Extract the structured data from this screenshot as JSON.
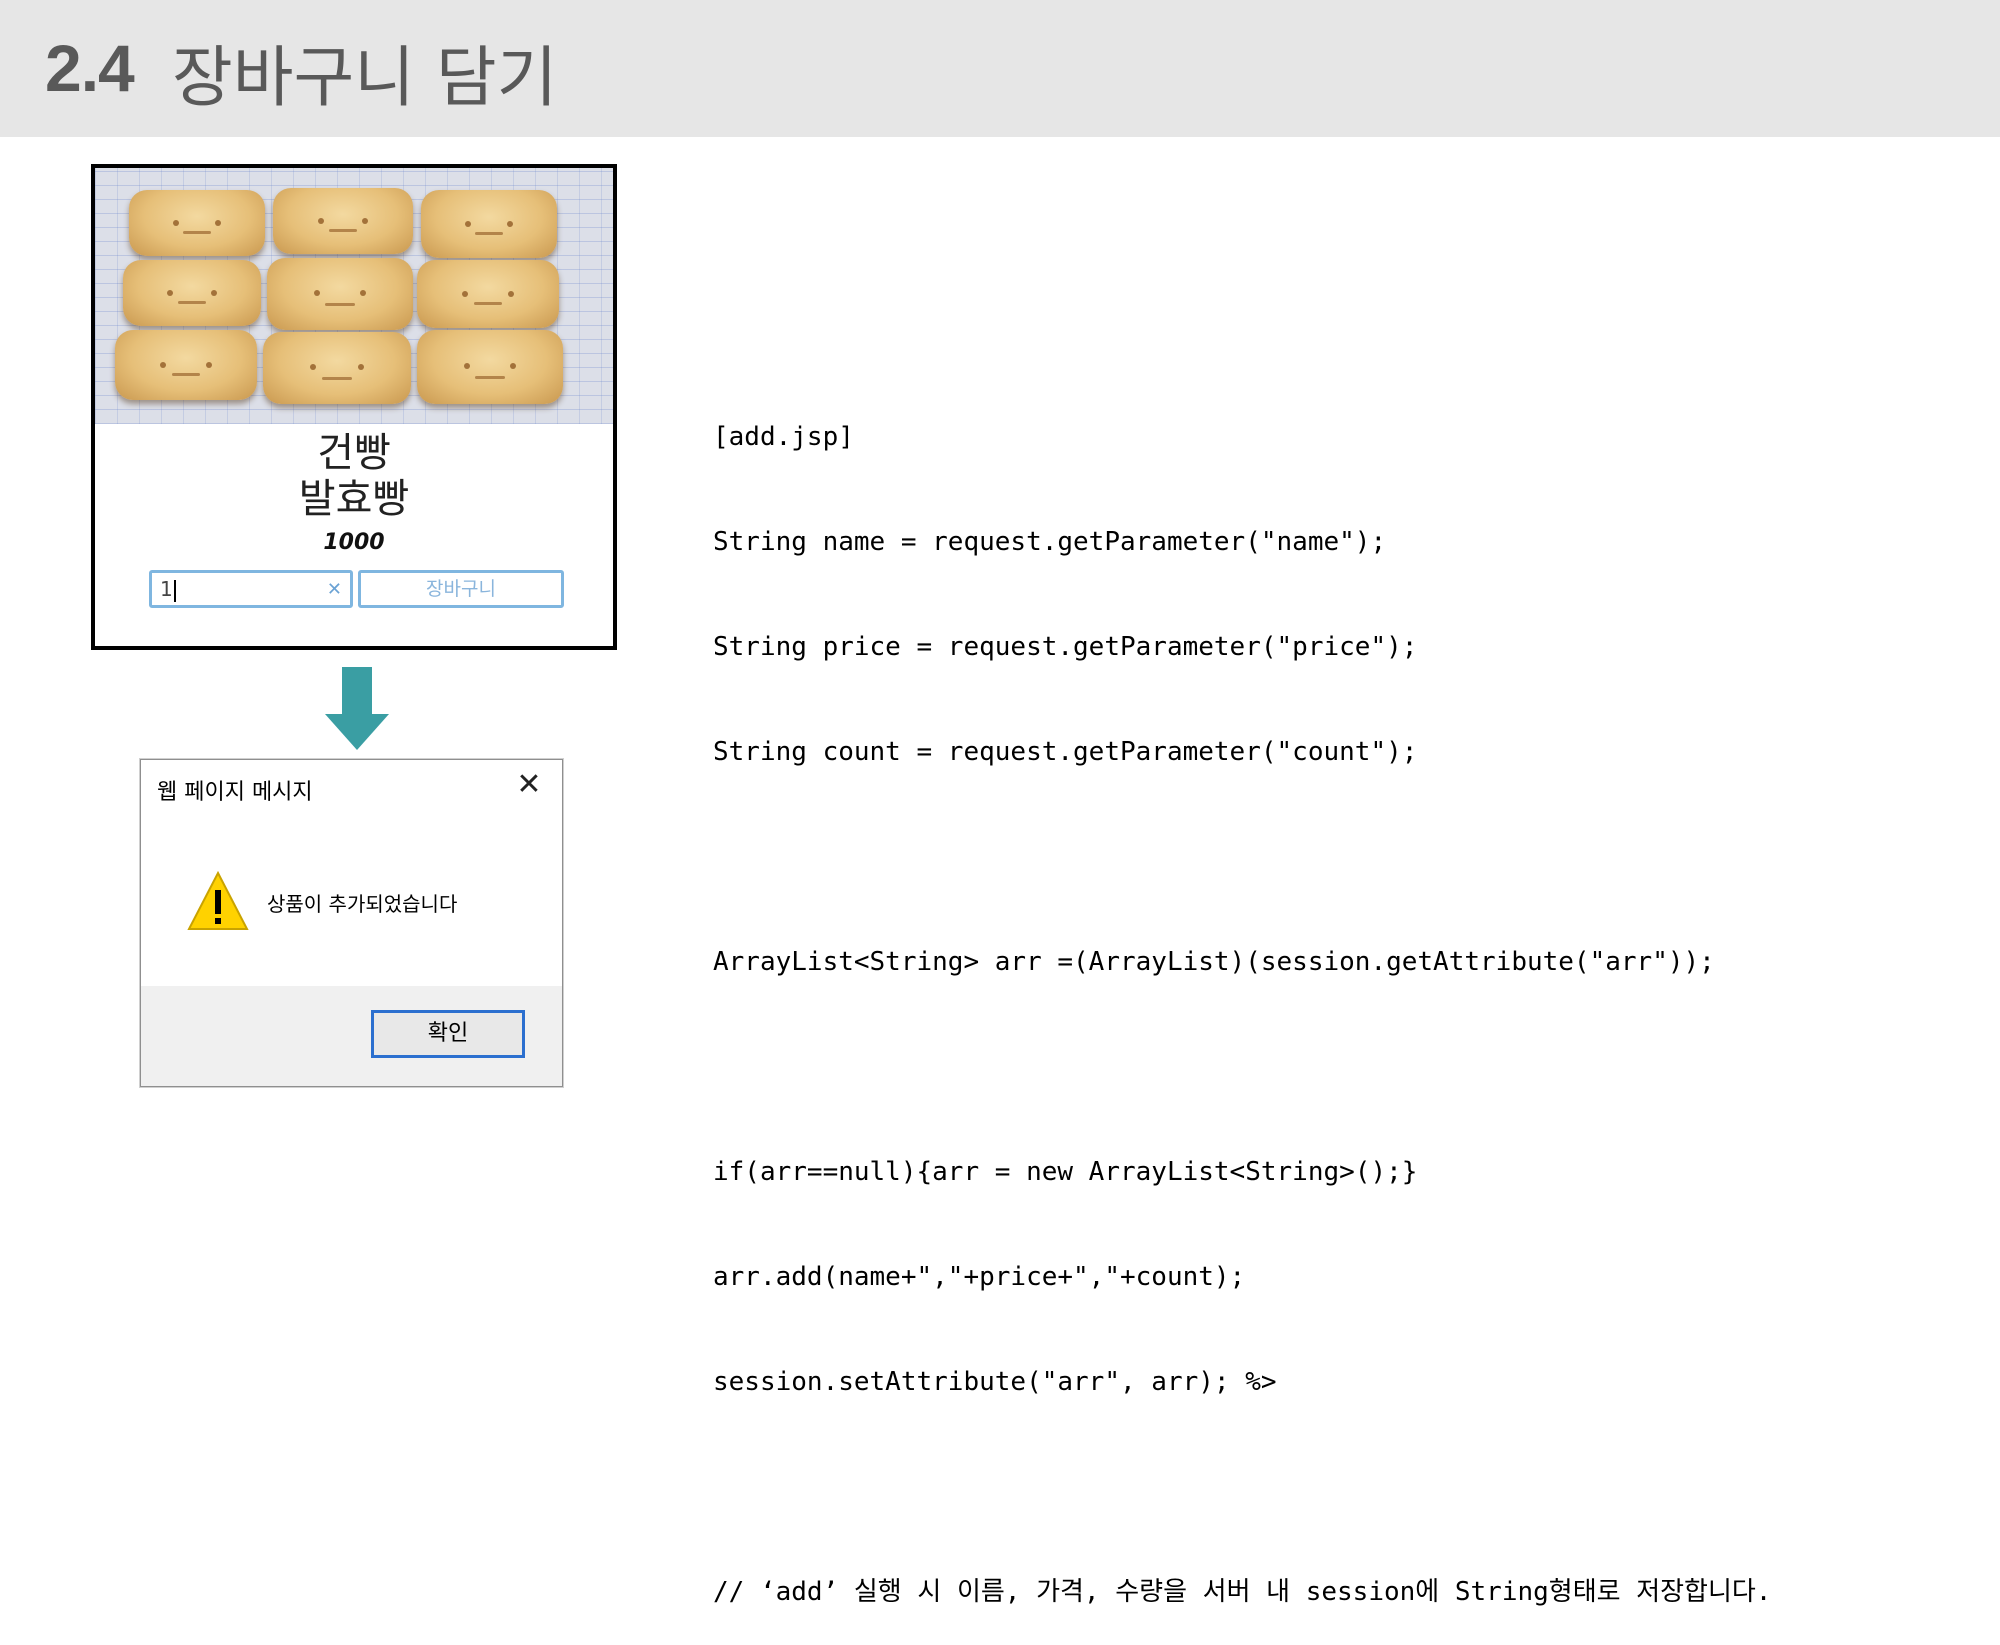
{
  "header": {
    "section_number": "2.4",
    "section_title": "장바구니 담기"
  },
  "product": {
    "name_line1": "건빵",
    "name_line2": "발효빵",
    "price": "1000",
    "quantity_value": "1",
    "clear_icon": "close-icon",
    "cart_button_label": "장바구니"
  },
  "arrow": {
    "color": "#3a9ea3"
  },
  "dialog": {
    "title": "웹 페이지 메시지",
    "close_icon": "close-icon",
    "warning_icon": "warning-icon",
    "message": "상품이 추가되었습니다",
    "ok_label": "확인"
  },
  "code": {
    "lines": [
      "[add.jsp]",
      "String name = request.getParameter(\"name\");",
      "String price = request.getParameter(\"price\");",
      "String count = request.getParameter(\"count\");",
      "",
      "ArrayList<String> arr =(ArrayList)(session.getAttribute(\"arr\"));",
      "",
      "if(arr==null){arr = new ArrayList<String>();}",
      "arr.add(name+\",\"+price+\",\"+count);",
      "session.setAttribute(\"arr\", arr); %>",
      "",
      "// ‘add’ 실행 시 이름, 가격, 수량을 서버 내 session에 String형태로 저장합니다."
    ]
  }
}
